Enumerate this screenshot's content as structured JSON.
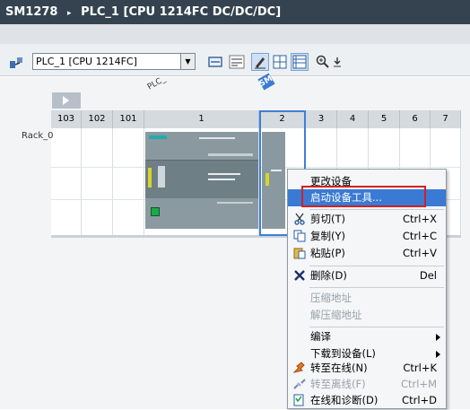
{
  "titlebar": {
    "device": "SM1278",
    "separator": "▸",
    "plc": "PLC_1 [CPU 1214FC DC/DC/DC]"
  },
  "toolbar": {
    "device_select": "PLC_1 [CPU 1214FC]"
  },
  "rack": {
    "row_label": "Rack_0",
    "slot_tags": {
      "plc": "PLC_",
      "sm": "SM"
    },
    "slots": [
      "103",
      "102",
      "101",
      "1",
      "2",
      "3",
      "4",
      "5",
      "6",
      "7"
    ]
  },
  "context_menu": {
    "items": [
      {
        "label": "更改设备",
        "shortcut": ""
      },
      {
        "label": "启动设备工具...",
        "shortcut": ""
      },
      {
        "label": "剪切(T)",
        "shortcut": "Ctrl+X"
      },
      {
        "label": "复制(Y)",
        "shortcut": "Ctrl+C"
      },
      {
        "label": "粘贴(P)",
        "shortcut": "Ctrl+V"
      },
      {
        "label": "删除(D)",
        "shortcut": "Del"
      },
      {
        "label": "压缩地址",
        "shortcut": ""
      },
      {
        "label": "解压缩地址",
        "shortcut": ""
      },
      {
        "label": "编译",
        "shortcut": ""
      },
      {
        "label": "下载到设备(L)",
        "shortcut": ""
      },
      {
        "label": "转至在线(N)",
        "shortcut": "Ctrl+K"
      },
      {
        "label": "转至离线(F)",
        "shortcut": "Ctrl+M"
      },
      {
        "label": "在线和诊断(D)",
        "shortcut": "Ctrl+D"
      }
    ]
  },
  "colors": {
    "titlebar": "#34434f",
    "selection": "#3a7ad4",
    "highlight_box": "#d42020",
    "cpu_module": "#7b8b93"
  }
}
